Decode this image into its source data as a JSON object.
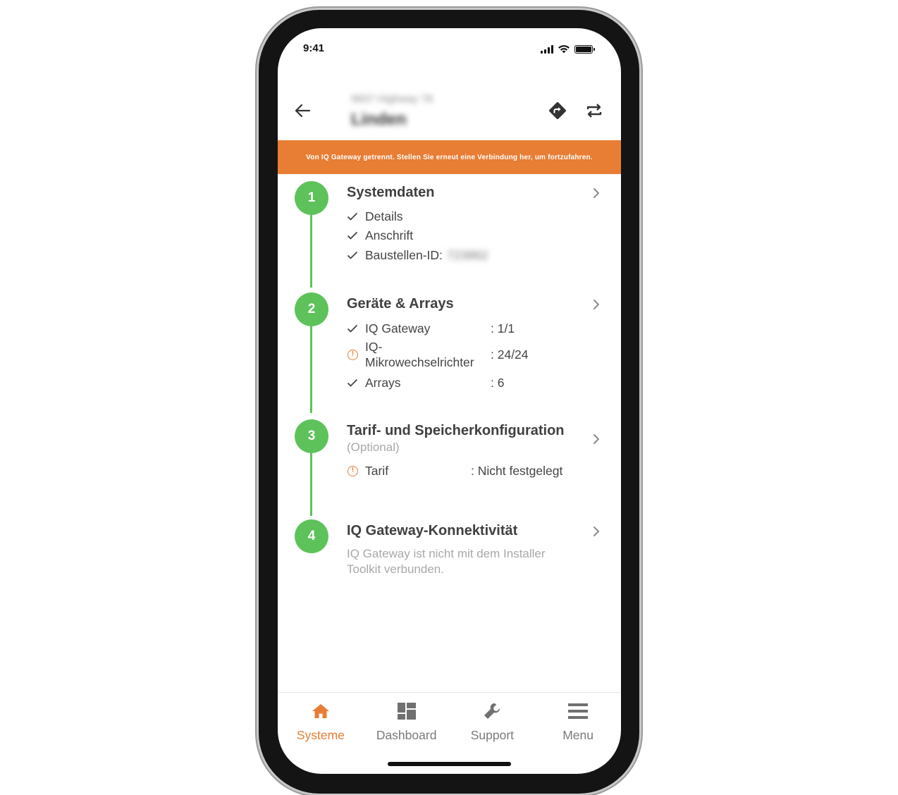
{
  "colors": {
    "accent": "#e87d34",
    "step_green": "#5ec25a",
    "banner_bg": "#e87d34"
  },
  "status_bar": {
    "time": "9:41",
    "icons": [
      "signal-icon",
      "wifi-icon",
      "battery-icon"
    ]
  },
  "header": {
    "back_icon": "arrow-left-icon",
    "subtitle": "9837 Highway 78",
    "title": "Linden",
    "action_icons": [
      "directions-icon",
      "sync-icon"
    ]
  },
  "banner": {
    "text": "Von IQ Gateway getrennt. Stellen Sie erneut eine Verbindung her, um fortzufahren."
  },
  "steps": [
    {
      "number": "1",
      "title": "Systemdaten",
      "items": [
        {
          "status": "check",
          "label": "Details"
        },
        {
          "status": "check",
          "label": "Anschrift"
        },
        {
          "status": "check",
          "label": "Baustellen-ID:",
          "value": "723862"
        }
      ]
    },
    {
      "number": "2",
      "title": "Geräte & Arrays",
      "items": [
        {
          "status": "check",
          "label": "IQ Gateway",
          "value": ": 1/1"
        },
        {
          "status": "warning",
          "label_line1": "IQ-",
          "label_line2": "Mikrowechselrichter",
          "value": ": 24/24"
        },
        {
          "status": "check",
          "label": "Arrays",
          "value": ": 6"
        }
      ]
    },
    {
      "number": "3",
      "title": "Tarif- und Speicherkonfiguration",
      "subtitle": "(Optional)",
      "items": [
        {
          "status": "warning",
          "label": "Tarif",
          "value": ": Nicht festgelegt"
        }
      ]
    },
    {
      "number": "4",
      "title": "IQ Gateway-Konnektivität",
      "description_line1": "IQ Gateway ist nicht mit dem Installer",
      "description_line2": "Toolkit verbunden."
    }
  ],
  "bottom_nav": [
    {
      "label": "Systeme",
      "icon": "home-icon",
      "active": true
    },
    {
      "label": "Dashboard",
      "icon": "dashboard-icon",
      "active": false
    },
    {
      "label": "Support",
      "icon": "wrench-icon",
      "active": false
    },
    {
      "label": "Menu",
      "icon": "menu-icon",
      "active": false
    }
  ]
}
